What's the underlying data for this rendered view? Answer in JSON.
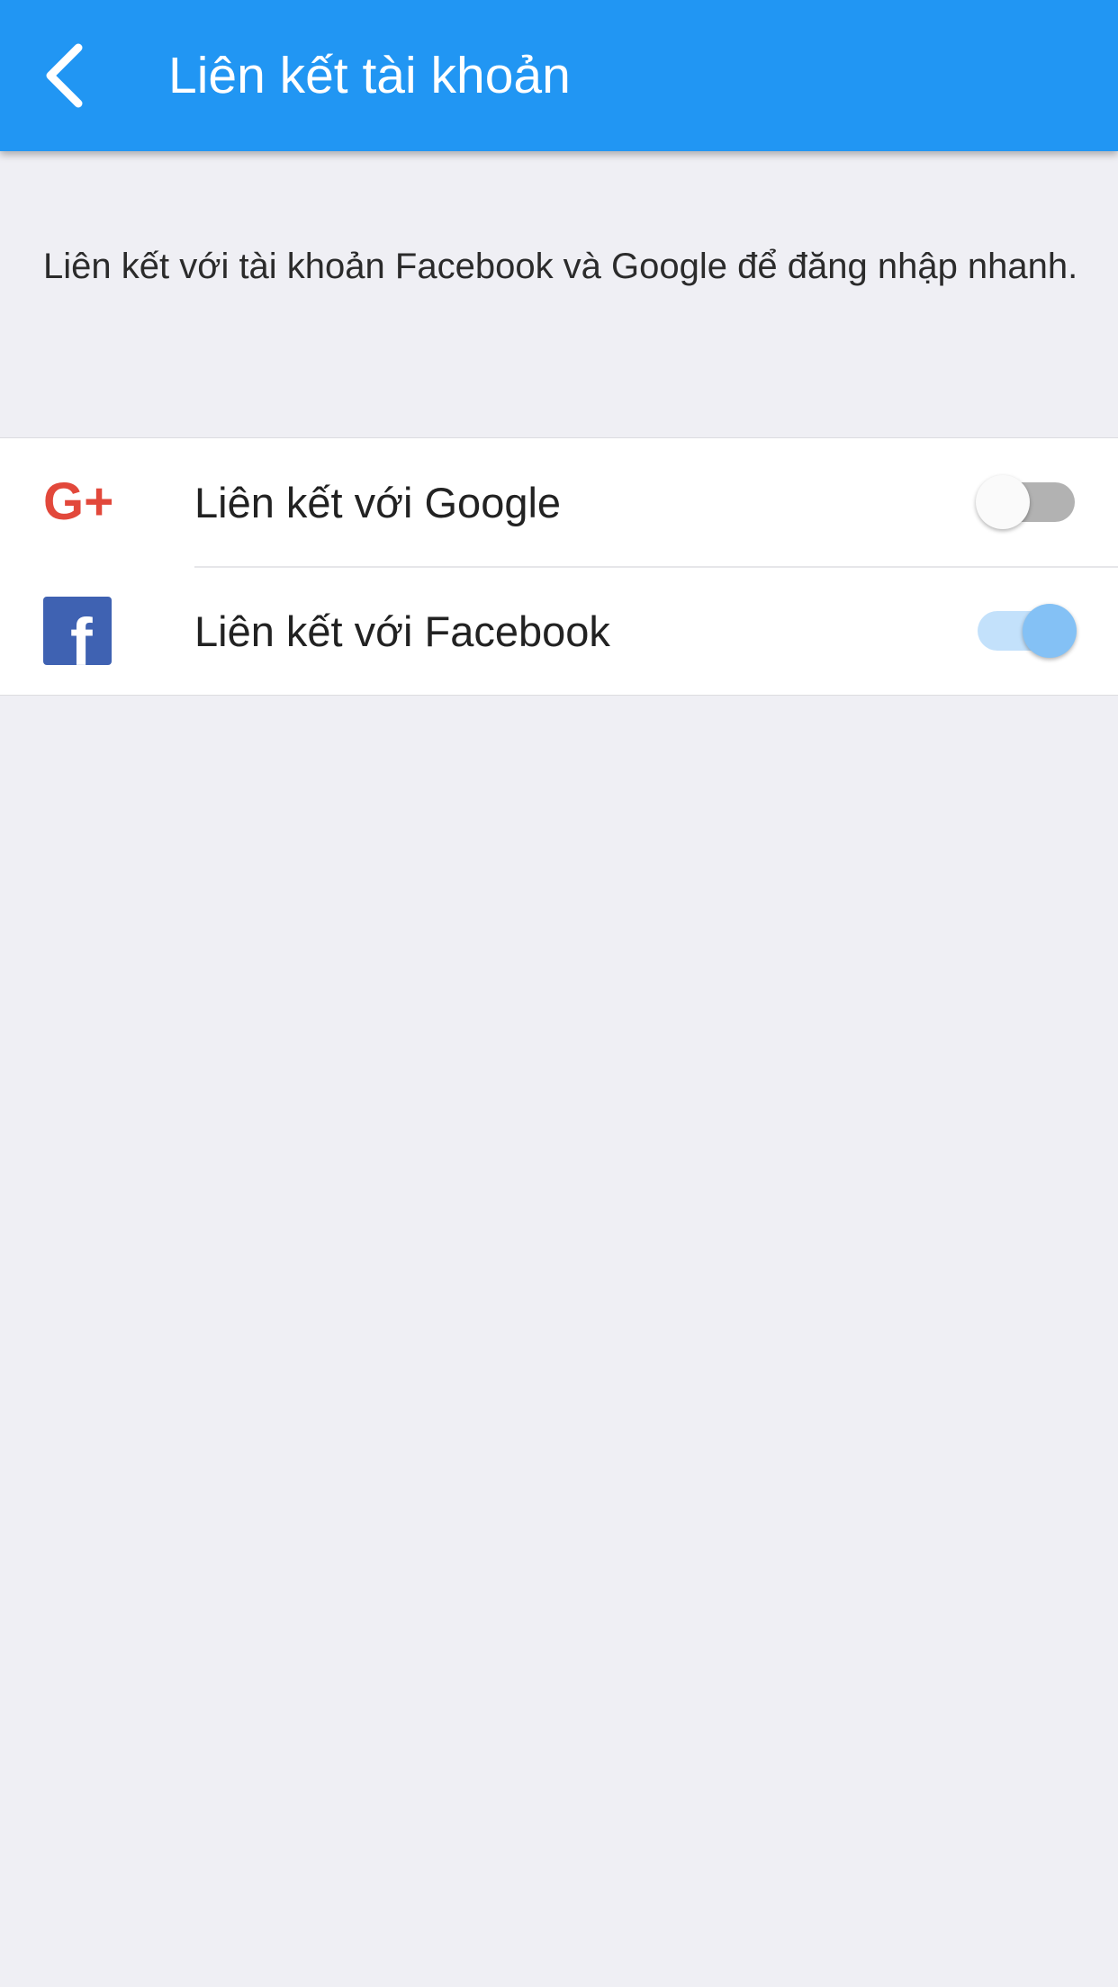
{
  "header": {
    "title": "Liên kết tài khoản",
    "back_icon": "chevron-left-icon"
  },
  "description": "Liên kết với tài khoản Facebook và Google để đăng nhập nhanh.",
  "accounts": [
    {
      "label": "Liên kết với Google",
      "icon": "google-plus-icon",
      "icon_text": "G+",
      "linked": false,
      "icon_color": "#e2483b"
    },
    {
      "label": "Liên kết với Facebook",
      "icon": "facebook-icon",
      "icon_text": "f",
      "linked": true,
      "icon_color": "#3f62b2"
    }
  ],
  "colors": {
    "app_bar": "#2196f3",
    "background": "#efeff4",
    "toggle_on_thumb": "#84c1f5",
    "toggle_on_track": "#c3e1fb",
    "toggle_off_thumb": "#fafafa",
    "toggle_off_track": "#b2b2b2"
  }
}
